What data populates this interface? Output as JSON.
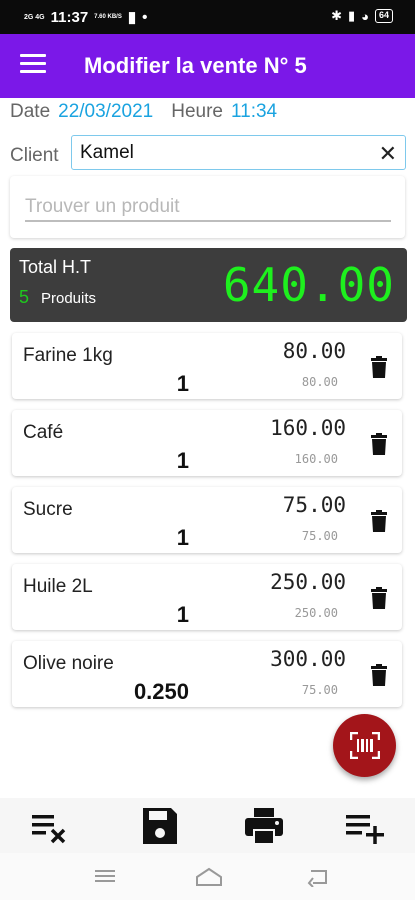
{
  "status_bar": {
    "network_top": "2G 4G",
    "time": "11:37",
    "speed": "7.60 KB/S",
    "icons": [
      "sd-card-icon",
      "dot-icon",
      "bluetooth-icon",
      "vibrate-icon",
      "wifi-icon"
    ],
    "battery": "64"
  },
  "app_bar": {
    "title": "Modifier la vente N° 5",
    "menu_icon": "hamburger-menu-icon",
    "color": "#7b18e8"
  },
  "info": {
    "date_label": "Date",
    "date_value": "22/03/2021",
    "time_label": "Heure",
    "time_value": "11:34"
  },
  "client": {
    "label": "Client",
    "value": "Kamel",
    "clear_icon": "close-icon"
  },
  "search": {
    "placeholder": "Trouver un produit"
  },
  "total": {
    "label": "Total H.T",
    "count": "5",
    "count_label": "Produits",
    "amount": "640.00"
  },
  "products": [
    {
      "name": "Farine 1kg",
      "qty": "1",
      "price": "80.00",
      "unit_price": "80.00"
    },
    {
      "name": "Café",
      "qty": "1",
      "price": "160.00",
      "unit_price": "160.00"
    },
    {
      "name": "Sucre",
      "qty": "1",
      "price": "75.00",
      "unit_price": "75.00"
    },
    {
      "name": "Huile 2L",
      "qty": "1",
      "price": "250.00",
      "unit_price": "250.00"
    },
    {
      "name": "Olive noire",
      "qty": "0.250",
      "price": "300.00",
      "unit_price": "75.00"
    }
  ],
  "fab": {
    "icon": "barcode-scan-icon",
    "color": "#a3151a"
  },
  "toolbar": {
    "buttons": [
      "clear-list-icon",
      "save-icon",
      "print-icon",
      "add-list-icon"
    ]
  },
  "nav": {
    "buttons": [
      "recent-apps-icon",
      "home-icon",
      "back-icon"
    ]
  }
}
